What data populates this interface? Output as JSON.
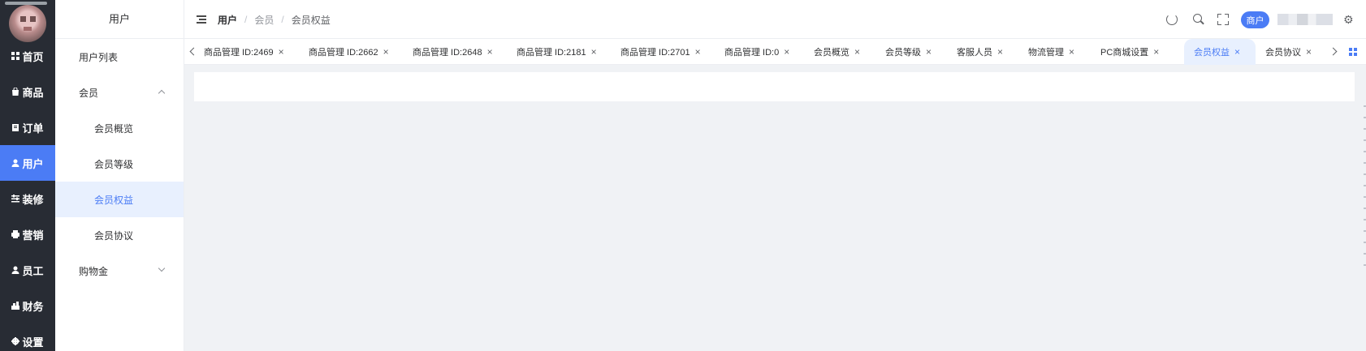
{
  "rail": {
    "items": [
      {
        "label": "首页",
        "icon": "grid-icon"
      },
      {
        "label": "商品",
        "icon": "bag-icon"
      },
      {
        "label": "订单",
        "icon": "clipboard-icon"
      },
      {
        "label": "用户",
        "icon": "user-icon"
      },
      {
        "label": "装修",
        "icon": "sliders-icon"
      },
      {
        "label": "营销",
        "icon": "printer-icon"
      },
      {
        "label": "员工",
        "icon": "person-icon"
      },
      {
        "label": "财务",
        "icon": "finance-icon"
      },
      {
        "label": "设置",
        "icon": "gear-icon"
      }
    ],
    "active_index": 3,
    "active_color": "#4b7cf5"
  },
  "submenu": {
    "title": "用户",
    "items": [
      {
        "label": "用户列表",
        "level": 1
      },
      {
        "label": "会员",
        "level": 1,
        "expanded": true
      },
      {
        "label": "会员概览",
        "level": 2
      },
      {
        "label": "会员等级",
        "level": 2
      },
      {
        "label": "会员权益",
        "level": 2,
        "active": true
      },
      {
        "label": "会员协议",
        "level": 2
      },
      {
        "label": "购物金",
        "level": 1,
        "expanded": false
      }
    ]
  },
  "header": {
    "breadcrumb": [
      "用户",
      "会员",
      "会员权益"
    ],
    "separator": "/",
    "merchant_label": "商户",
    "icons": [
      "refresh-icon",
      "search-icon",
      "fullscreen-icon",
      "settings-icon"
    ]
  },
  "tabs": {
    "items": [
      "商品管理 ID:2469",
      "商品管理 ID:2662",
      "商品管理 ID:2648",
      "商品管理 ID:2181",
      "商品管理 ID:2701",
      "商品管理 ID:0",
      "会员概览",
      "会员等级",
      "客服人员",
      "物流管理",
      "PC商城设置",
      "会员权益",
      "会员协议"
    ],
    "active_index": 11,
    "close_glyph": "×"
  }
}
